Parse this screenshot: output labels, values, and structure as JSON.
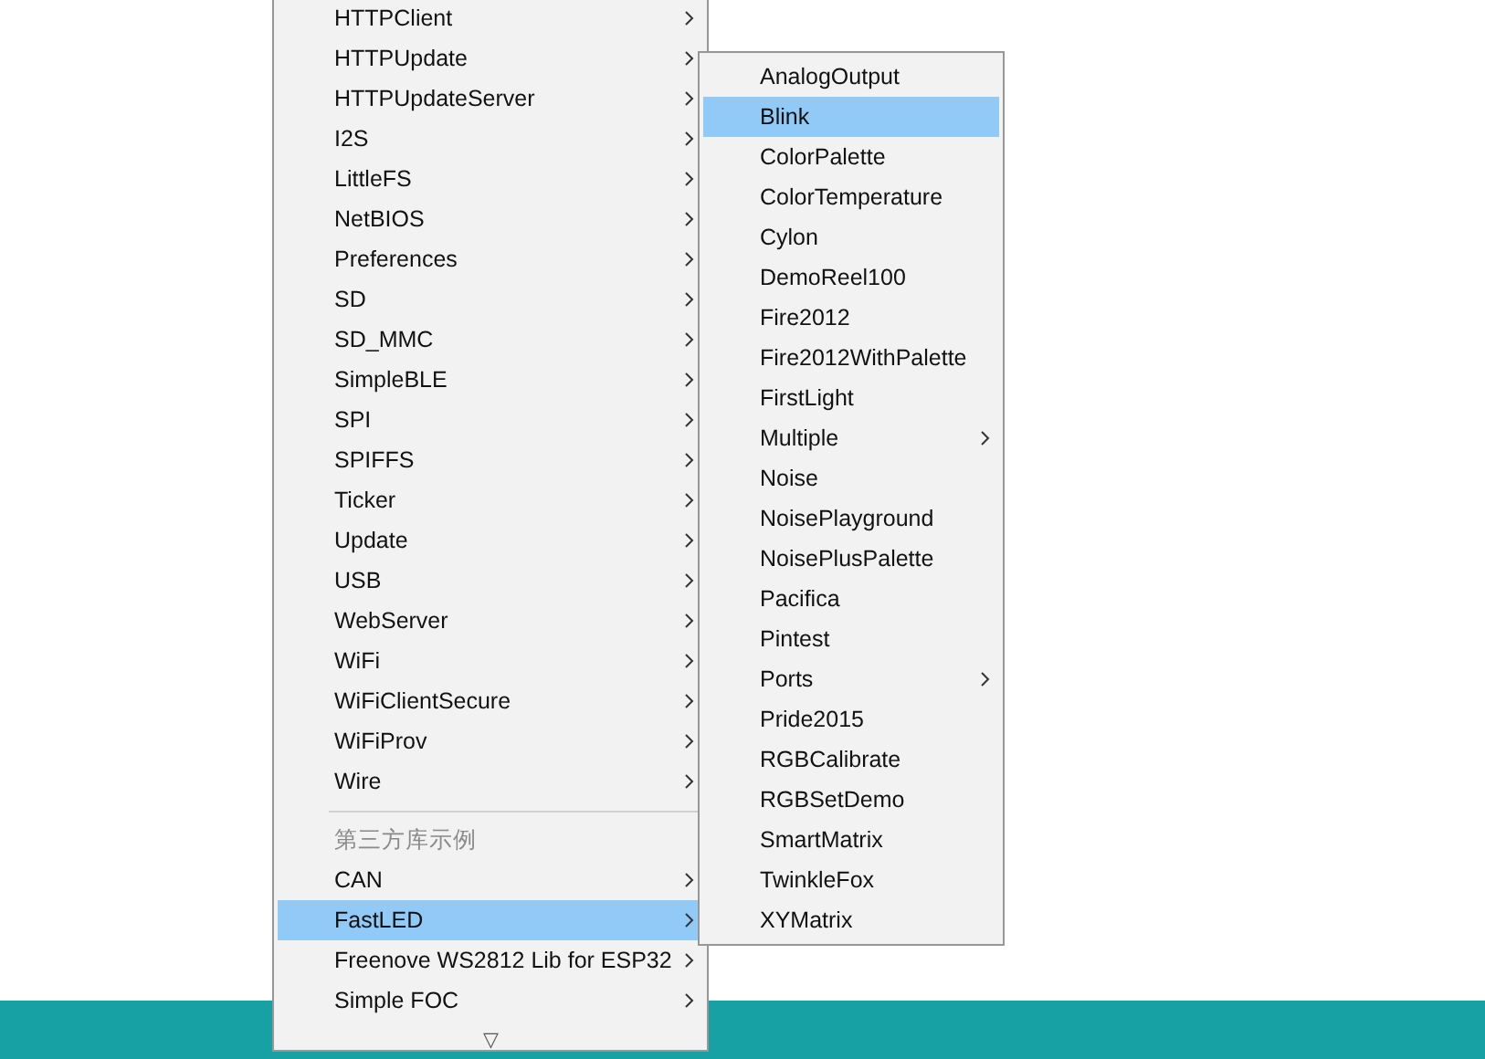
{
  "menu": {
    "items": [
      {
        "kind": "item",
        "label": "HTTPClient",
        "submenu": true,
        "selected": false
      },
      {
        "kind": "item",
        "label": "HTTPUpdate",
        "submenu": true,
        "selected": false
      },
      {
        "kind": "item",
        "label": "HTTPUpdateServer",
        "submenu": true,
        "selected": false
      },
      {
        "kind": "item",
        "label": "I2S",
        "submenu": true,
        "selected": false
      },
      {
        "kind": "item",
        "label": "LittleFS",
        "submenu": true,
        "selected": false
      },
      {
        "kind": "item",
        "label": "NetBIOS",
        "submenu": true,
        "selected": false
      },
      {
        "kind": "item",
        "label": "Preferences",
        "submenu": true,
        "selected": false
      },
      {
        "kind": "item",
        "label": "SD",
        "submenu": true,
        "selected": false
      },
      {
        "kind": "item",
        "label": "SD_MMC",
        "submenu": true,
        "selected": false
      },
      {
        "kind": "item",
        "label": "SimpleBLE",
        "submenu": true,
        "selected": false
      },
      {
        "kind": "item",
        "label": "SPI",
        "submenu": true,
        "selected": false
      },
      {
        "kind": "item",
        "label": "SPIFFS",
        "submenu": true,
        "selected": false
      },
      {
        "kind": "item",
        "label": "Ticker",
        "submenu": true,
        "selected": false
      },
      {
        "kind": "item",
        "label": "Update",
        "submenu": true,
        "selected": false
      },
      {
        "kind": "item",
        "label": "USB",
        "submenu": true,
        "selected": false
      },
      {
        "kind": "item",
        "label": "WebServer",
        "submenu": true,
        "selected": false
      },
      {
        "kind": "item",
        "label": "WiFi",
        "submenu": true,
        "selected": false
      },
      {
        "kind": "item",
        "label": "WiFiClientSecure",
        "submenu": true,
        "selected": false
      },
      {
        "kind": "item",
        "label": "WiFiProv",
        "submenu": true,
        "selected": false
      },
      {
        "kind": "item",
        "label": "Wire",
        "submenu": true,
        "selected": false
      },
      {
        "kind": "separator"
      },
      {
        "kind": "header",
        "label": "第三方库示例"
      },
      {
        "kind": "item",
        "label": "CAN",
        "submenu": true,
        "selected": false
      },
      {
        "kind": "item",
        "label": "FastLED",
        "submenu": true,
        "selected": true
      },
      {
        "kind": "item",
        "label": "Freenove WS2812 Lib for ESP32",
        "submenu": true,
        "selected": false
      },
      {
        "kind": "item",
        "label": "Simple FOC",
        "submenu": true,
        "selected": false
      }
    ],
    "scroll_down": "▽"
  },
  "submenu": {
    "items": [
      {
        "label": "AnalogOutput",
        "submenu": false,
        "selected": false
      },
      {
        "label": "Blink",
        "submenu": false,
        "selected": true
      },
      {
        "label": "ColorPalette",
        "submenu": false,
        "selected": false
      },
      {
        "label": "ColorTemperature",
        "submenu": false,
        "selected": false
      },
      {
        "label": "Cylon",
        "submenu": false,
        "selected": false
      },
      {
        "label": "DemoReel100",
        "submenu": false,
        "selected": false
      },
      {
        "label": "Fire2012",
        "submenu": false,
        "selected": false
      },
      {
        "label": "Fire2012WithPalette",
        "submenu": false,
        "selected": false
      },
      {
        "label": "FirstLight",
        "submenu": false,
        "selected": false
      },
      {
        "label": "Multiple",
        "submenu": true,
        "selected": false
      },
      {
        "label": "Noise",
        "submenu": false,
        "selected": false
      },
      {
        "label": "NoisePlayground",
        "submenu": false,
        "selected": false
      },
      {
        "label": "NoisePlusPalette",
        "submenu": false,
        "selected": false
      },
      {
        "label": "Pacifica",
        "submenu": false,
        "selected": false
      },
      {
        "label": "Pintest",
        "submenu": false,
        "selected": false
      },
      {
        "label": "Ports",
        "submenu": true,
        "selected": false
      },
      {
        "label": "Pride2015",
        "submenu": false,
        "selected": false
      },
      {
        "label": "RGBCalibrate",
        "submenu": false,
        "selected": false
      },
      {
        "label": "RGBSetDemo",
        "submenu": false,
        "selected": false
      },
      {
        "label": "SmartMatrix",
        "submenu": false,
        "selected": false
      },
      {
        "label": "TwinkleFox",
        "submenu": false,
        "selected": false
      },
      {
        "label": "XYMatrix",
        "submenu": false,
        "selected": false
      }
    ]
  }
}
